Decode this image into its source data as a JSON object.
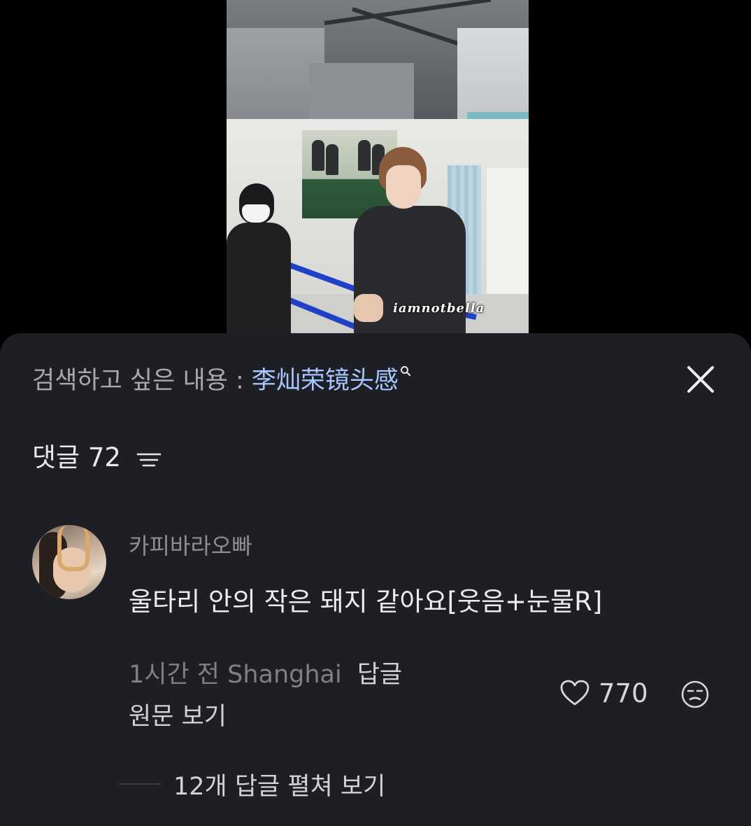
{
  "video": {
    "watermark": "iamnotbella"
  },
  "panel": {
    "search_prefix": "검색하고 싶은 내용 : ",
    "search_term": "李灿荣镜头感",
    "comments_label": "댓글",
    "comments_count": "72"
  },
  "comment": {
    "username": "카피바라오빠",
    "text": "울타리 안의 작은 돼지 같아요[웃음+눈물R]",
    "time_location": "1시간 전 Shanghai",
    "reply_label": "답글",
    "see_original": "원문 보기",
    "likes": "770",
    "expand_replies": "12개 답글 펼쳐 보기"
  },
  "colors": {
    "panel_bg": "#1e1f24",
    "search_term": "#a7c6ff",
    "railing": "#2040c8"
  }
}
